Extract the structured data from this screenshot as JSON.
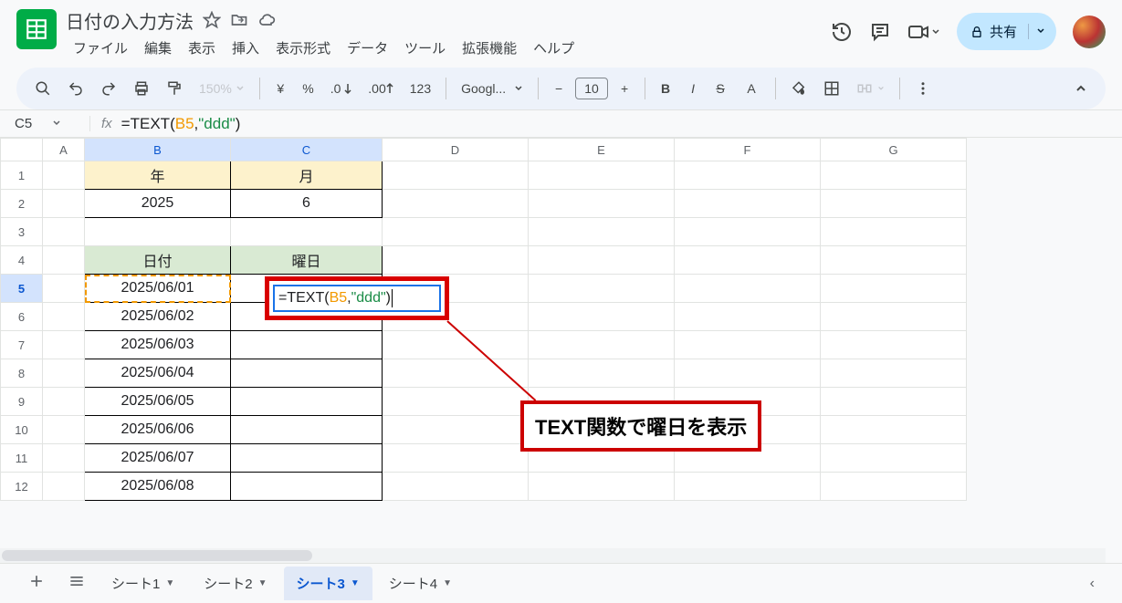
{
  "doc_title": "日付の入力方法",
  "menubar": [
    "ファイル",
    "編集",
    "表示",
    "挿入",
    "表示形式",
    "データ",
    "ツール",
    "拡張機能",
    "ヘルプ"
  ],
  "share": {
    "label": "共有"
  },
  "toolbar": {
    "zoom": "150%",
    "font": "Googl...",
    "font_size": "10"
  },
  "name_box": "C5",
  "formula": {
    "raw": "=TEXT(B5,\"ddd\")",
    "eq": "=",
    "fn": "TEXT",
    "open": "(",
    "ref": "B5",
    "comma": ",",
    "str": "\"ddd\"",
    "close": ")"
  },
  "columns": [
    "A",
    "B",
    "C",
    "D",
    "E",
    "F",
    "G"
  ],
  "rows": [
    "1",
    "2",
    "3",
    "4",
    "5",
    "6",
    "7",
    "8",
    "9",
    "10",
    "11",
    "12"
  ],
  "cells": {
    "B1": "年",
    "C1": "月",
    "B2": "2025",
    "C2": "6",
    "B4": "日付",
    "C4": "曜日",
    "B5": "2025/06/01",
    "B6": "2025/06/02",
    "B7": "2025/06/03",
    "B8": "2025/06/04",
    "B9": "2025/06/05",
    "B10": "2025/06/06",
    "B11": "2025/06/07",
    "B12": "2025/06/08"
  },
  "annotation": {
    "text": "TEXT関数で曜日を表示"
  },
  "tabs": [
    {
      "label": "シート1",
      "active": false
    },
    {
      "label": "シート2",
      "active": false
    },
    {
      "label": "シート3",
      "active": true
    },
    {
      "label": "シート4",
      "active": false
    }
  ]
}
